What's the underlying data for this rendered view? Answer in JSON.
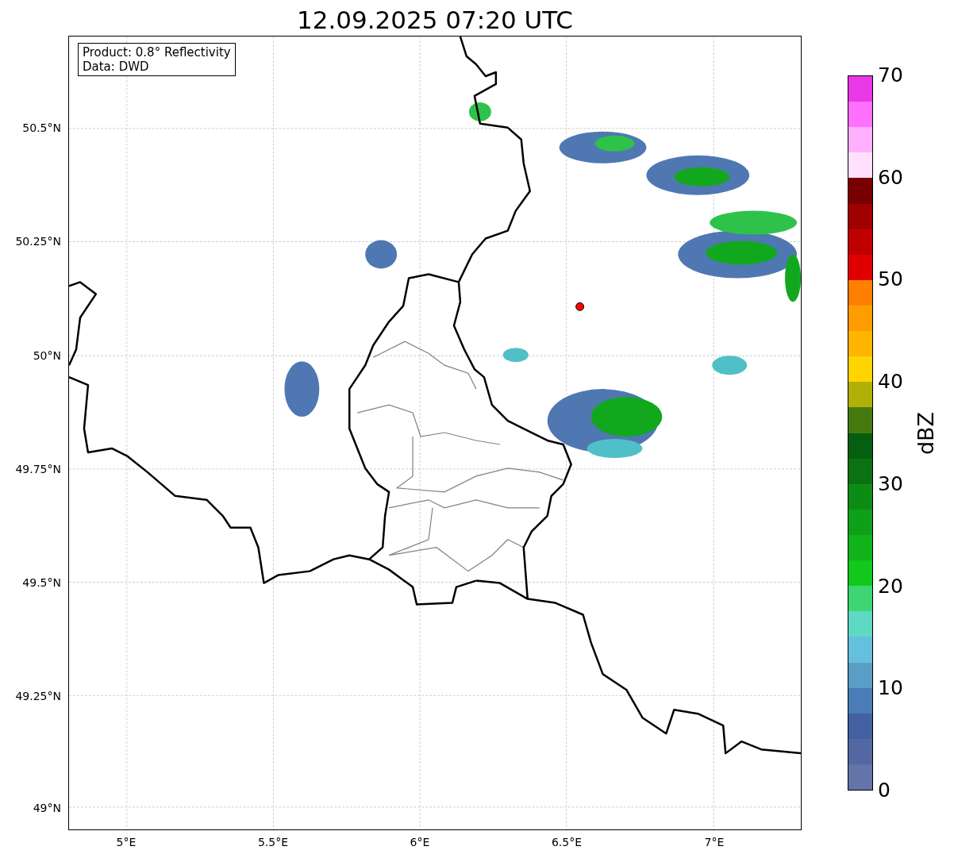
{
  "title": "12.09.2025 07:20 UTC",
  "info_box": [
    "Product: 0.8° Reflectivity",
    "Data: DWD"
  ],
  "y_ticks": [
    "50.5°N",
    "50.25°N",
    "50°N",
    "49.75°N",
    "49.5°N",
    "49.25°N",
    "49°N"
  ],
  "x_ticks": [
    "5°E",
    "5.5°E",
    "6°E",
    "6.5°E",
    "7°E"
  ],
  "colorbar": {
    "label": "dBZ",
    "ticks": [
      "70",
      "60",
      "50",
      "40",
      "30",
      "20",
      "10",
      "0"
    ],
    "bins": [
      {
        "color": "#e838e8"
      },
      {
        "color": "#ff70ff"
      },
      {
        "color": "#ffb0ff"
      },
      {
        "color": "#ffe0ff"
      },
      {
        "color": "#780000"
      },
      {
        "color": "#a00000"
      },
      {
        "color": "#c00000"
      },
      {
        "color": "#e00000"
      },
      {
        "color": "#ff8000"
      },
      {
        "color": "#ff9c00"
      },
      {
        "color": "#ffb400"
      },
      {
        "color": "#ffd400"
      },
      {
        "color": "#b0b008"
      },
      {
        "color": "#467a0e"
      },
      {
        "color": "#065e10"
      },
      {
        "color": "#0a7212"
      },
      {
        "color": "#0c8c15"
      },
      {
        "color": "#0ea018"
      },
      {
        "color": "#10b41a"
      },
      {
        "color": "#12c81c"
      },
      {
        "color": "#3dd672"
      },
      {
        "color": "#5fd8c4"
      },
      {
        "color": "#64c0dc"
      },
      {
        "color": "#5a9ec8"
      },
      {
        "color": "#4a7db5"
      },
      {
        "color": "#4460a3"
      },
      {
        "color": "#5368a2"
      },
      {
        "color": "#6574a8"
      }
    ]
  }
}
